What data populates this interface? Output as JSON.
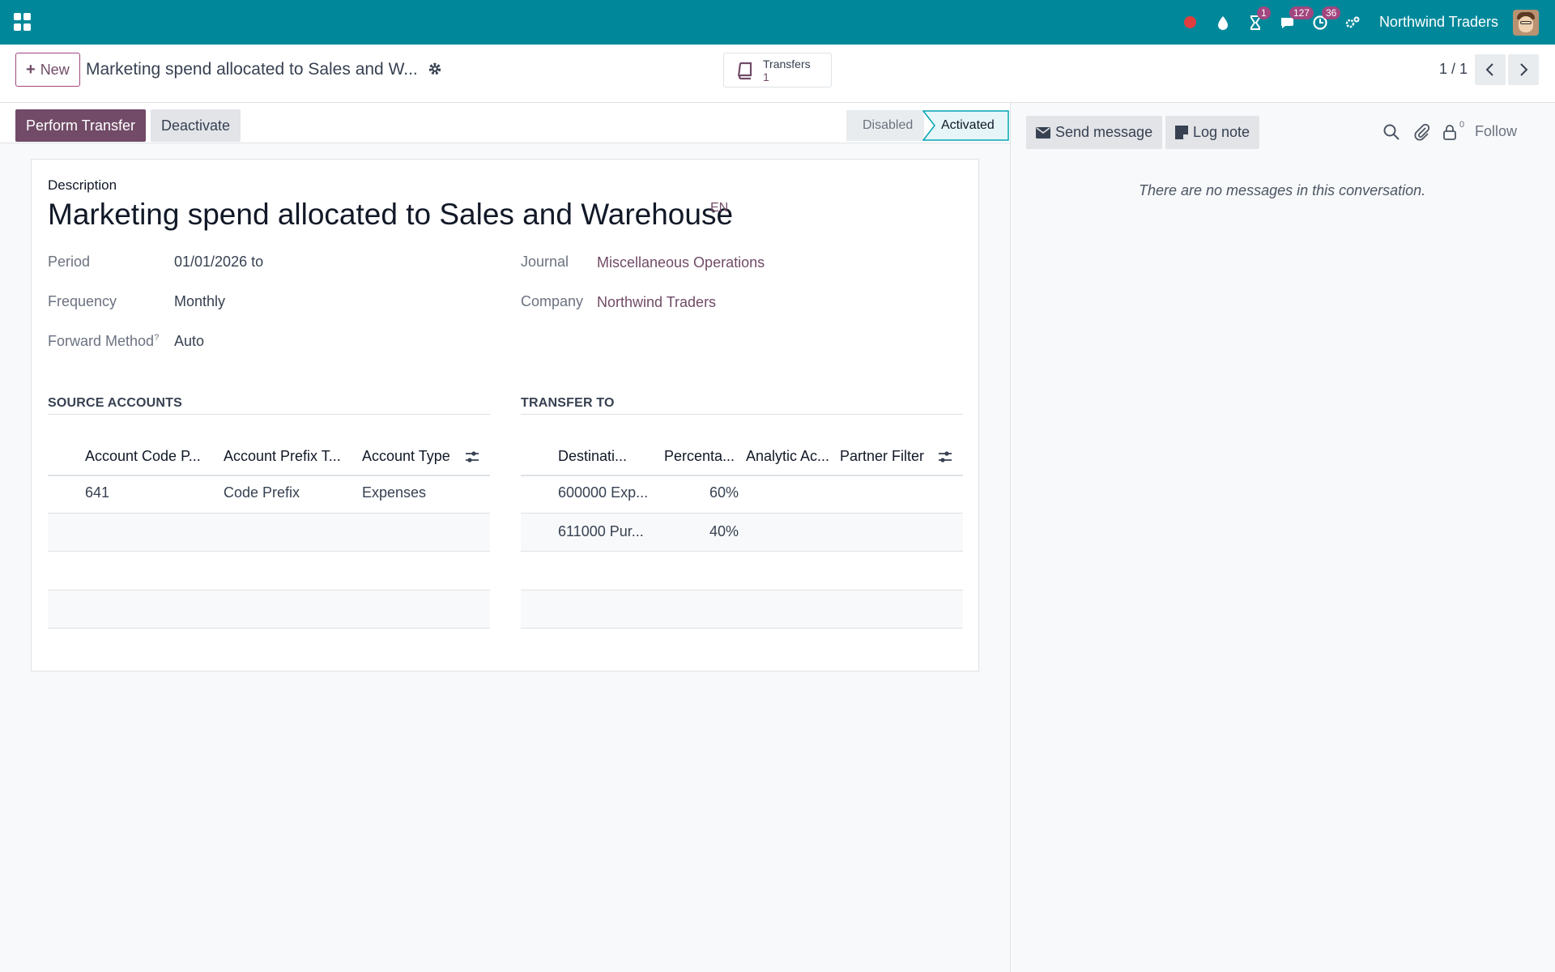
{
  "navbar": {
    "company": "Northwind Traders",
    "activity_badge": "1",
    "messages_badge": "127",
    "clock_badge": "36",
    "accent": "#00889a"
  },
  "control_panel": {
    "new_label": "New",
    "record_title": "Marketing spend allocated to Sales and W...",
    "smart_button": {
      "label": "Transfers",
      "count": "1"
    },
    "pager": "1 / 1"
  },
  "statusbar": {
    "primary_label": "Perform Transfer",
    "secondary_label": "Deactivate",
    "stages": [
      "Disabled",
      "Activated"
    ],
    "active_stage": "Activated"
  },
  "form": {
    "description_label": "Description",
    "description": "Marketing spend allocated to Sales and Warehouse",
    "lang": "EN",
    "fields_left": [
      {
        "label": "Period",
        "value": "01/01/2026 to"
      },
      {
        "label": "Frequency",
        "value": "Monthly"
      },
      {
        "label": "Forward Method",
        "help": "?",
        "value": "Auto"
      }
    ],
    "fields_right": [
      {
        "label": "Journal",
        "value": "Miscellaneous Operations"
      },
      {
        "label": "Company",
        "value": "Northwind Traders"
      }
    ],
    "source_accounts": {
      "title": "SOURCE ACCOUNTS",
      "headers": [
        "Account Code P...",
        "Account Prefix T...",
        "Account Type"
      ],
      "rows": [
        [
          "641",
          "Code Prefix",
          "Expenses"
        ]
      ]
    },
    "transfer_to": {
      "title": "TRANSFER TO",
      "headers": [
        "Destinati...",
        "Percenta...",
        "Analytic Ac...",
        "Partner Filter"
      ],
      "rows": [
        [
          "600000 Exp...",
          "60%",
          "",
          ""
        ],
        [
          "611000 Pur...",
          "40%",
          "",
          ""
        ]
      ]
    }
  },
  "chatter": {
    "send_message": "Send message",
    "log_note": "Log note",
    "followers_count": "0",
    "follow_label": "Follow",
    "empty_text": "There are no messages in this conversation."
  }
}
